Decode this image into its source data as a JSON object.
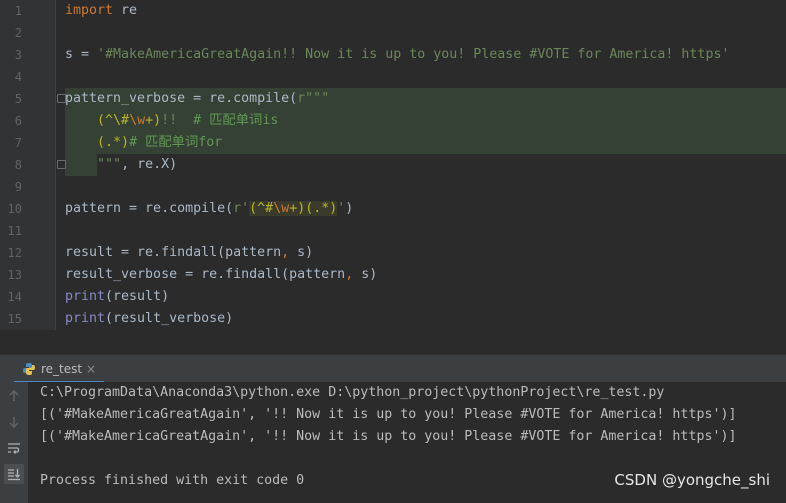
{
  "editor": {
    "lines": [
      {
        "num": "1"
      },
      {
        "num": "2"
      },
      {
        "num": "3"
      },
      {
        "num": "4"
      },
      {
        "num": "5"
      },
      {
        "num": "6"
      },
      {
        "num": "7"
      },
      {
        "num": "8"
      },
      {
        "num": "9"
      },
      {
        "num": "10"
      },
      {
        "num": "11"
      },
      {
        "num": "12"
      },
      {
        "num": "13"
      },
      {
        "num": "14"
      },
      {
        "num": "15"
      }
    ],
    "tokens": {
      "l1_kw": "import",
      "l1_rest": " re",
      "l3_a": "s = ",
      "l3_str": "'#MakeAmericaGreatAgain!! Now it is up to you! Please #VOTE for America! https'",
      "l5_a": "pattern_verbose = re.compile(",
      "l5_str": "r\"\"\"",
      "l6_indent": "    ",
      "l6_rx1": "(^\\#",
      "l6_esc": "\\w",
      "l6_rx2": "+)",
      "l6_str": "!!  ",
      "l6_cm": "# 匹配单词is",
      "l7_indent": "    ",
      "l7_rx": "(.*)",
      "l7_cm": "# 匹配单词for",
      "l8_indent": "    ",
      "l8_str": "\"\"\"",
      "l8_rest": ", re.X)",
      "l10_a": "pattern = re.compile(",
      "l10_str1": "r'",
      "l10_rx1": "(^#",
      "l10_esc": "\\w",
      "l10_rx2": "+)(.*)",
      "l10_str2": "'",
      "l10_b": ")",
      "l12_a": "result = re.findall(pattern",
      "l12_comma": ",",
      "l12_b": " s)",
      "l13_a": "result_verbose = re.findall(pattern",
      "l13_comma": ",",
      "l13_b": " s)",
      "l14_bi": "print",
      "l14_rest": "(result)",
      "l15_bi": "print",
      "l15_rest": "(result_verbose)"
    }
  },
  "run_panel": {
    "tab_label": "re_test",
    "tab_close": "×",
    "console_lines": [
      "C:\\ProgramData\\Anaconda3\\python.exe D:\\python_project\\pythonProject\\re_test.py",
      "[('#MakeAmericaGreatAgain', '!! Now it is up to you! Please #VOTE for America! https')]",
      "[('#MakeAmericaGreatAgain', '!! Now it is up to you! Please #VOTE for America! https')]",
      "",
      "Process finished with exit code 0"
    ],
    "strip_icons": [
      "arrow-up-icon",
      "arrow-down-icon",
      "soft-wrap-icon",
      "scroll-to-end-icon"
    ]
  },
  "watermark": "CSDN @yongche_shi",
  "colors": {
    "background": "#2b2b2b",
    "keyword": "#cc7832",
    "string": "#6a8759",
    "comment": "#629755",
    "regex": "#bbb529",
    "builtin": "#8888c6",
    "highlight": "#344134"
  }
}
